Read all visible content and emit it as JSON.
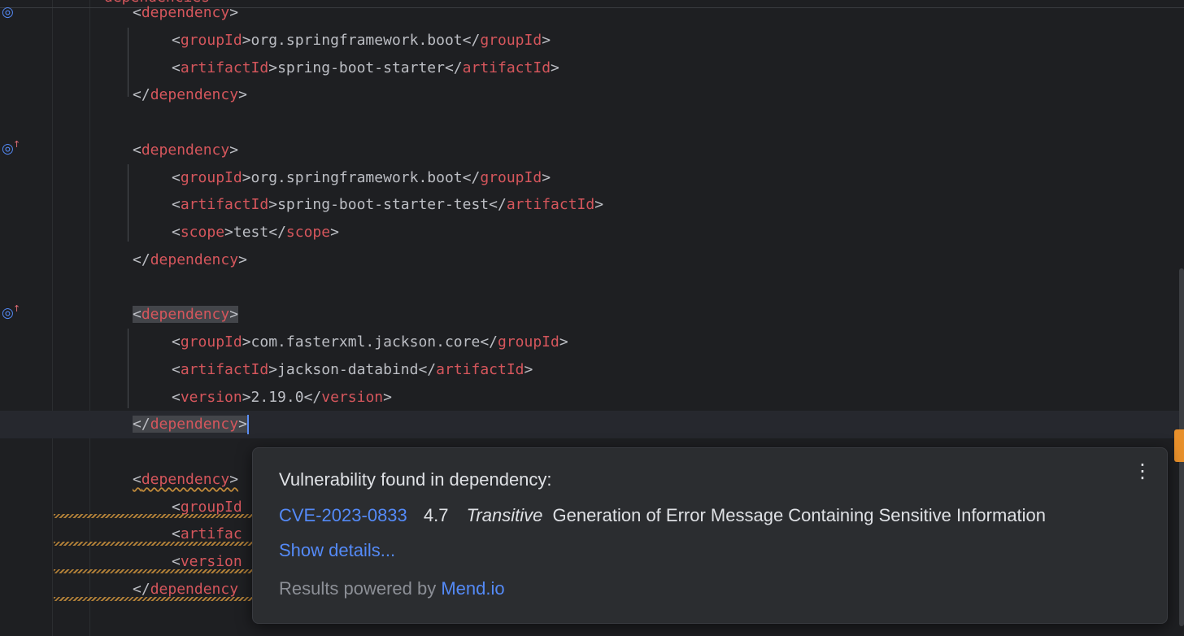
{
  "editor": {
    "partial_top_line": "dependencies",
    "lines": [
      {
        "kind": "open",
        "tag": "dependency"
      },
      {
        "kind": "elem",
        "tag": "groupId",
        "text": "org.springframework.boot"
      },
      {
        "kind": "elem",
        "tag": "artifactId",
        "text": "spring-boot-starter"
      },
      {
        "kind": "close",
        "tag": "dependency"
      },
      {
        "kind": "open",
        "tag": "dependency"
      },
      {
        "kind": "elem",
        "tag": "groupId",
        "text": "org.springframework.boot"
      },
      {
        "kind": "elem",
        "tag": "artifactId",
        "text": "spring-boot-starter-test"
      },
      {
        "kind": "elem",
        "tag": "scope",
        "text": "test"
      },
      {
        "kind": "close",
        "tag": "dependency"
      },
      {
        "kind": "open",
        "tag": "dependency",
        "highlighted": true
      },
      {
        "kind": "elem",
        "tag": "groupId",
        "text": "com.fasterxml.jackson.core"
      },
      {
        "kind": "elem",
        "tag": "artifactId",
        "text": "jackson-databind"
      },
      {
        "kind": "elem",
        "tag": "version",
        "text": "2.19.0"
      },
      {
        "kind": "close",
        "tag": "dependency",
        "highlighted": true,
        "caret": true
      },
      {
        "kind": "open",
        "tag": "dependency",
        "warning": true
      },
      {
        "kind": "partial",
        "text": "<groupId"
      },
      {
        "kind": "partial",
        "text": "<artifac"
      },
      {
        "kind": "partial",
        "text": "<version"
      },
      {
        "kind": "partial",
        "text": "</dependency"
      }
    ]
  },
  "popup": {
    "title": "Vulnerability found in dependency:",
    "menu_icon": "more-vertical-icon",
    "cve_id": "CVE-2023-0833",
    "score": "4.7",
    "type": "Transitive",
    "description": "Generation of Error Message Containing Sensitive Information",
    "show_details": "Show details...",
    "powered_prefix": "Results powered by ",
    "powered_link": "Mend.io"
  },
  "colors": {
    "tag": "#d5565c",
    "link": "#548af7",
    "warning": "#e8902b"
  }
}
